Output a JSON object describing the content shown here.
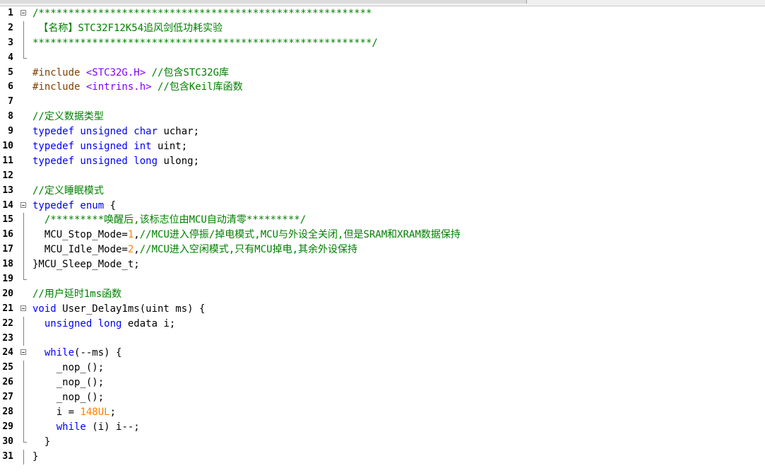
{
  "editor": {
    "lines": [
      {
        "n": "1",
        "fold": "open",
        "segs": [
          {
            "t": "comment",
            "s": "/********************************************************"
          }
        ]
      },
      {
        "n": "2",
        "fold": "line",
        "segs": [
          {
            "t": "comment",
            "s": " 【名称】STC32F12K54追风剑低功耗实验"
          }
        ]
      },
      {
        "n": "3",
        "fold": "line",
        "segs": [
          {
            "t": "comment",
            "s": "*********************************************************/"
          }
        ]
      },
      {
        "n": "4",
        "fold": "end",
        "segs": []
      },
      {
        "n": "5",
        "fold": "",
        "segs": [
          {
            "t": "pre",
            "s": "#include "
          },
          {
            "t": "str",
            "s": "<STC32G.H>"
          },
          {
            "t": "txt",
            "s": " "
          },
          {
            "t": "comment",
            "s": "//包含STC32G库"
          }
        ]
      },
      {
        "n": "6",
        "fold": "",
        "segs": [
          {
            "t": "pre",
            "s": "#include "
          },
          {
            "t": "str",
            "s": "<intrins.h>"
          },
          {
            "t": "txt",
            "s": " "
          },
          {
            "t": "comment",
            "s": "//包含Keil库函数"
          }
        ]
      },
      {
        "n": "7",
        "fold": "",
        "segs": []
      },
      {
        "n": "8",
        "fold": "",
        "segs": [
          {
            "t": "comment",
            "s": "//定义数据类型"
          }
        ]
      },
      {
        "n": "9",
        "fold": "",
        "segs": [
          {
            "t": "kw",
            "s": "typedef unsigned char"
          },
          {
            "t": "txt",
            "s": " uchar;"
          }
        ]
      },
      {
        "n": "10",
        "fold": "",
        "segs": [
          {
            "t": "kw",
            "s": "typedef unsigned int"
          },
          {
            "t": "txt",
            "s": " uint;"
          }
        ]
      },
      {
        "n": "11",
        "fold": "",
        "segs": [
          {
            "t": "kw",
            "s": "typedef unsigned long"
          },
          {
            "t": "txt",
            "s": " ulong;"
          }
        ]
      },
      {
        "n": "12",
        "fold": "",
        "segs": []
      },
      {
        "n": "13",
        "fold": "",
        "segs": [
          {
            "t": "comment",
            "s": "//定义睡眠模式"
          }
        ]
      },
      {
        "n": "14",
        "fold": "open",
        "segs": [
          {
            "t": "kw",
            "s": "typedef enum"
          },
          {
            "t": "txt",
            "s": " {"
          }
        ]
      },
      {
        "n": "15",
        "fold": "line",
        "segs": [
          {
            "t": "txt",
            "s": "  "
          },
          {
            "t": "comment",
            "s": "/*********唤醒后,该标志位由MCU自动清零*********/"
          }
        ]
      },
      {
        "n": "16",
        "fold": "line",
        "segs": [
          {
            "t": "txt",
            "s": "  MCU_Stop_Mode="
          },
          {
            "t": "num",
            "s": "1"
          },
          {
            "t": "txt",
            "s": ","
          },
          {
            "t": "comment",
            "s": "//MCU进入停振/掉电模式,MCU与外设全关闭,但是SRAM和XRAM数据保持"
          }
        ]
      },
      {
        "n": "17",
        "fold": "line",
        "segs": [
          {
            "t": "txt",
            "s": "  MCU_Idle_Mode="
          },
          {
            "t": "num",
            "s": "2"
          },
          {
            "t": "txt",
            "s": ","
          },
          {
            "t": "comment",
            "s": "//MCU进入空闲模式,只有MCU掉电,其余外设保持"
          }
        ]
      },
      {
        "n": "18",
        "fold": "line",
        "segs": [
          {
            "t": "txt",
            "s": "}MCU_Sleep_Mode_t;"
          }
        ]
      },
      {
        "n": "19",
        "fold": "end",
        "segs": []
      },
      {
        "n": "20",
        "fold": "",
        "segs": [
          {
            "t": "comment",
            "s": "//用户延时1ms函数"
          }
        ]
      },
      {
        "n": "21",
        "fold": "open",
        "segs": [
          {
            "t": "kw",
            "s": "void"
          },
          {
            "t": "txt",
            "s": " User_Delay1ms(uint ms) {"
          }
        ]
      },
      {
        "n": "22",
        "fold": "line",
        "segs": [
          {
            "t": "txt",
            "s": "  "
          },
          {
            "t": "kw",
            "s": "unsigned long"
          },
          {
            "t": "txt",
            "s": " edata i;"
          }
        ]
      },
      {
        "n": "23",
        "fold": "line",
        "segs": []
      },
      {
        "n": "24",
        "fold": "open",
        "segs": [
          {
            "t": "txt",
            "s": "  "
          },
          {
            "t": "kw",
            "s": "while"
          },
          {
            "t": "txt",
            "s": "(--ms) {"
          }
        ]
      },
      {
        "n": "25",
        "fold": "line",
        "segs": [
          {
            "t": "txt",
            "s": "    _nop_();"
          }
        ]
      },
      {
        "n": "26",
        "fold": "line",
        "segs": [
          {
            "t": "txt",
            "s": "    _nop_();"
          }
        ]
      },
      {
        "n": "27",
        "fold": "line",
        "segs": [
          {
            "t": "txt",
            "s": "    _nop_();"
          }
        ]
      },
      {
        "n": "28",
        "fold": "line",
        "segs": [
          {
            "t": "txt",
            "s": "    i = "
          },
          {
            "t": "num",
            "s": "148UL"
          },
          {
            "t": "txt",
            "s": ";"
          }
        ]
      },
      {
        "n": "29",
        "fold": "line",
        "segs": [
          {
            "t": "txt",
            "s": "    "
          },
          {
            "t": "kw",
            "s": "while"
          },
          {
            "t": "txt",
            "s": " (i) i--;"
          }
        ]
      },
      {
        "n": "30",
        "fold": "end",
        "segs": [
          {
            "t": "txt",
            "s": "  }"
          }
        ]
      },
      {
        "n": "31",
        "fold": "line",
        "segs": [
          {
            "t": "txt",
            "s": "}"
          }
        ]
      }
    ]
  }
}
